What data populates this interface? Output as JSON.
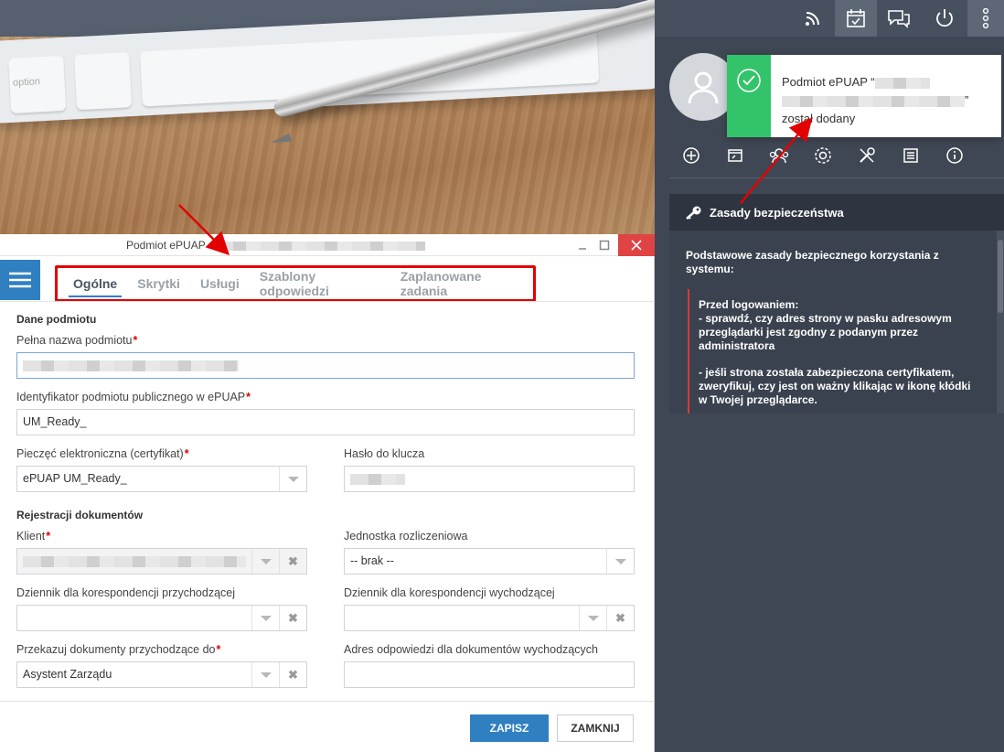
{
  "header": {
    "icons": [
      "rss-icon",
      "calendar-check-icon",
      "chat-icon",
      "power-icon",
      "more-vertical-icon"
    ]
  },
  "toast": {
    "line1": "Podmiot ePUAP “",
    "line2_end": "”",
    "line3": "został dodany"
  },
  "security": {
    "title": "Zasady bezpieczeństwa",
    "intro": "Podstawowe zasady bezpiecznego korzystania z systemu:",
    "rule_title": "Przed logowaniem:",
    "rule_1": "- sprawdź, czy adres strony w pasku adresowym przeglądarki jest zgodny z podanym przez administratora",
    "rule_2": "- jeśli strona została zabezpieczona certyfikatem, zweryfikuj, czy jest on ważny klikając w ikonę kłódki w Twojej przeglądarce."
  },
  "dialog": {
    "title": "Podmiot ePUAP - ",
    "tabs": [
      "Ogólne",
      "Skrytki",
      "Usługi",
      "Szablony odpowiedzi",
      "Zaplanowane zadania"
    ],
    "section_entity": "Dane podmiotu",
    "full_name_label": "Pełna nazwa podmiotu",
    "identifier_label": "Identyfikator podmiotu publicznego w ePUAP",
    "identifier_value": "UM_Ready_",
    "seal_label": "Pieczęć elektroniczna (certyfikat)",
    "seal_value": "ePUAP UM_Ready_",
    "key_password_label": "Hasło do klucza",
    "section_registration": "Rejestracji dokumentów",
    "client_label": "Klient",
    "unit_label": "Jednostka rozliczeniowa",
    "unit_value": "-- brak --",
    "incoming_log_label": "Dziennik dla korespondencji przychodzącej",
    "outgoing_log_label": "Dziennik dla korespondencji wychodzącej",
    "forward_label": "Przekazuj dokumenty przychodzące do",
    "forward_value": "Asystent Zarządu",
    "reply_address_label": "Adres odpowiedzi dla dokumentów wychodzących",
    "required_mark": "*",
    "save": "ZAPISZ",
    "close": "ZAMKNIJ"
  },
  "keyboard": {
    "key_label": "option"
  },
  "colors": {
    "accent": "#2f7fc1",
    "annotation": "#e30000",
    "success": "#33c46b",
    "close_red": "#e04343",
    "panel_dark": "#404754"
  }
}
